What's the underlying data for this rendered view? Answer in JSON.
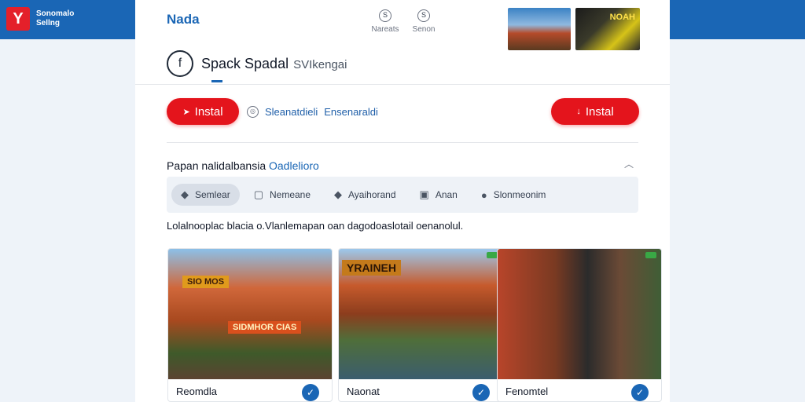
{
  "brand": {
    "logo_glyph": "Y",
    "line1": "Sonomalo",
    "line2": "Sellng"
  },
  "header": {
    "app_name": "Nada",
    "icons": [
      {
        "glyph": "S",
        "label": "Nareats",
        "icon": "search-icon"
      },
      {
        "glyph": "S",
        "label": "Senon",
        "icon": "user-icon"
      }
    ],
    "thumbnails": [
      {
        "label": ""
      },
      {
        "label": "NOAH"
      }
    ]
  },
  "profile": {
    "avatar_glyph": "f",
    "title": "Spack Spadal",
    "subtitle": "SVIkengai"
  },
  "actions": {
    "install_left": "Instal",
    "install_right": "Instal",
    "meta_a": "Sleanatdieli",
    "meta_b": "Ensenaraldi"
  },
  "section": {
    "title_plain": "Papan nalidalbansia ",
    "title_highlight": "Oadlelioro",
    "tabs": [
      {
        "label": "Semlear",
        "icon": "chat-bubble-icon",
        "glyph": "◆"
      },
      {
        "label": "Nemeane",
        "icon": "message-square-icon",
        "glyph": "▢"
      },
      {
        "label": "Ayaihorand",
        "icon": "speech-icon",
        "glyph": "◆"
      },
      {
        "label": "Anan",
        "icon": "image-icon",
        "glyph": "▣"
      },
      {
        "label": "Slonmeonim",
        "icon": "pin-icon",
        "glyph": "●"
      }
    ],
    "description": "Lolalnooplac blacia o.Vlanlemapan oan dagodoaslotail oenanolul."
  },
  "cards": [
    {
      "caption": "Reomdla",
      "sign_a": "SIO MOS",
      "sign_b": "SIDMHOR CIAS"
    },
    {
      "caption": "Naonat",
      "sign_a": "YRAINEH",
      "sign_b": ""
    },
    {
      "caption": "Fenomtel",
      "sign_a": "",
      "sign_b": ""
    }
  ],
  "colors": {
    "brand_blue": "#1a66b5",
    "install_red": "#e4141c",
    "check_blue": "#1a66b5"
  }
}
